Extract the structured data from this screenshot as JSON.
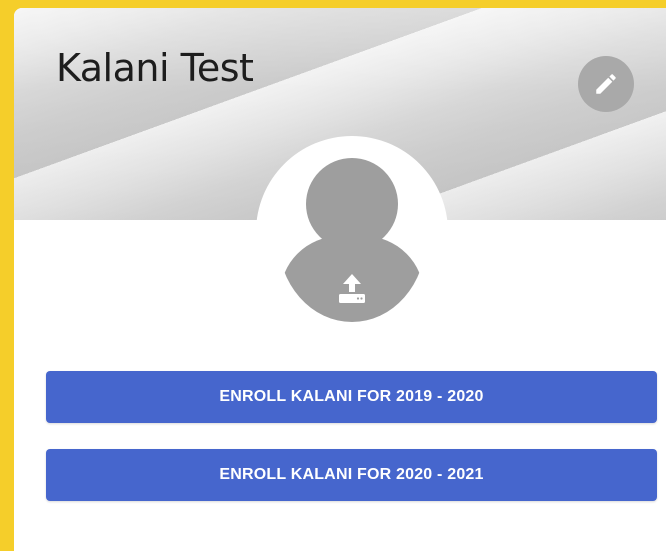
{
  "profile": {
    "name": "Kalani Test"
  },
  "icons": {
    "edit": "pencil-icon",
    "avatar": "person-avatar-icon",
    "upload": "upload-icon"
  },
  "actions": {
    "enroll_1": "ENROLL KALANI FOR 2019 - 2020",
    "enroll_2": "ENROLL KALANI FOR 2020 - 2021"
  },
  "colors": {
    "background": "#f5ce2a",
    "button": "#4666cd",
    "avatar": "#9e9e9e",
    "edit_button": "#a9a9a9"
  }
}
